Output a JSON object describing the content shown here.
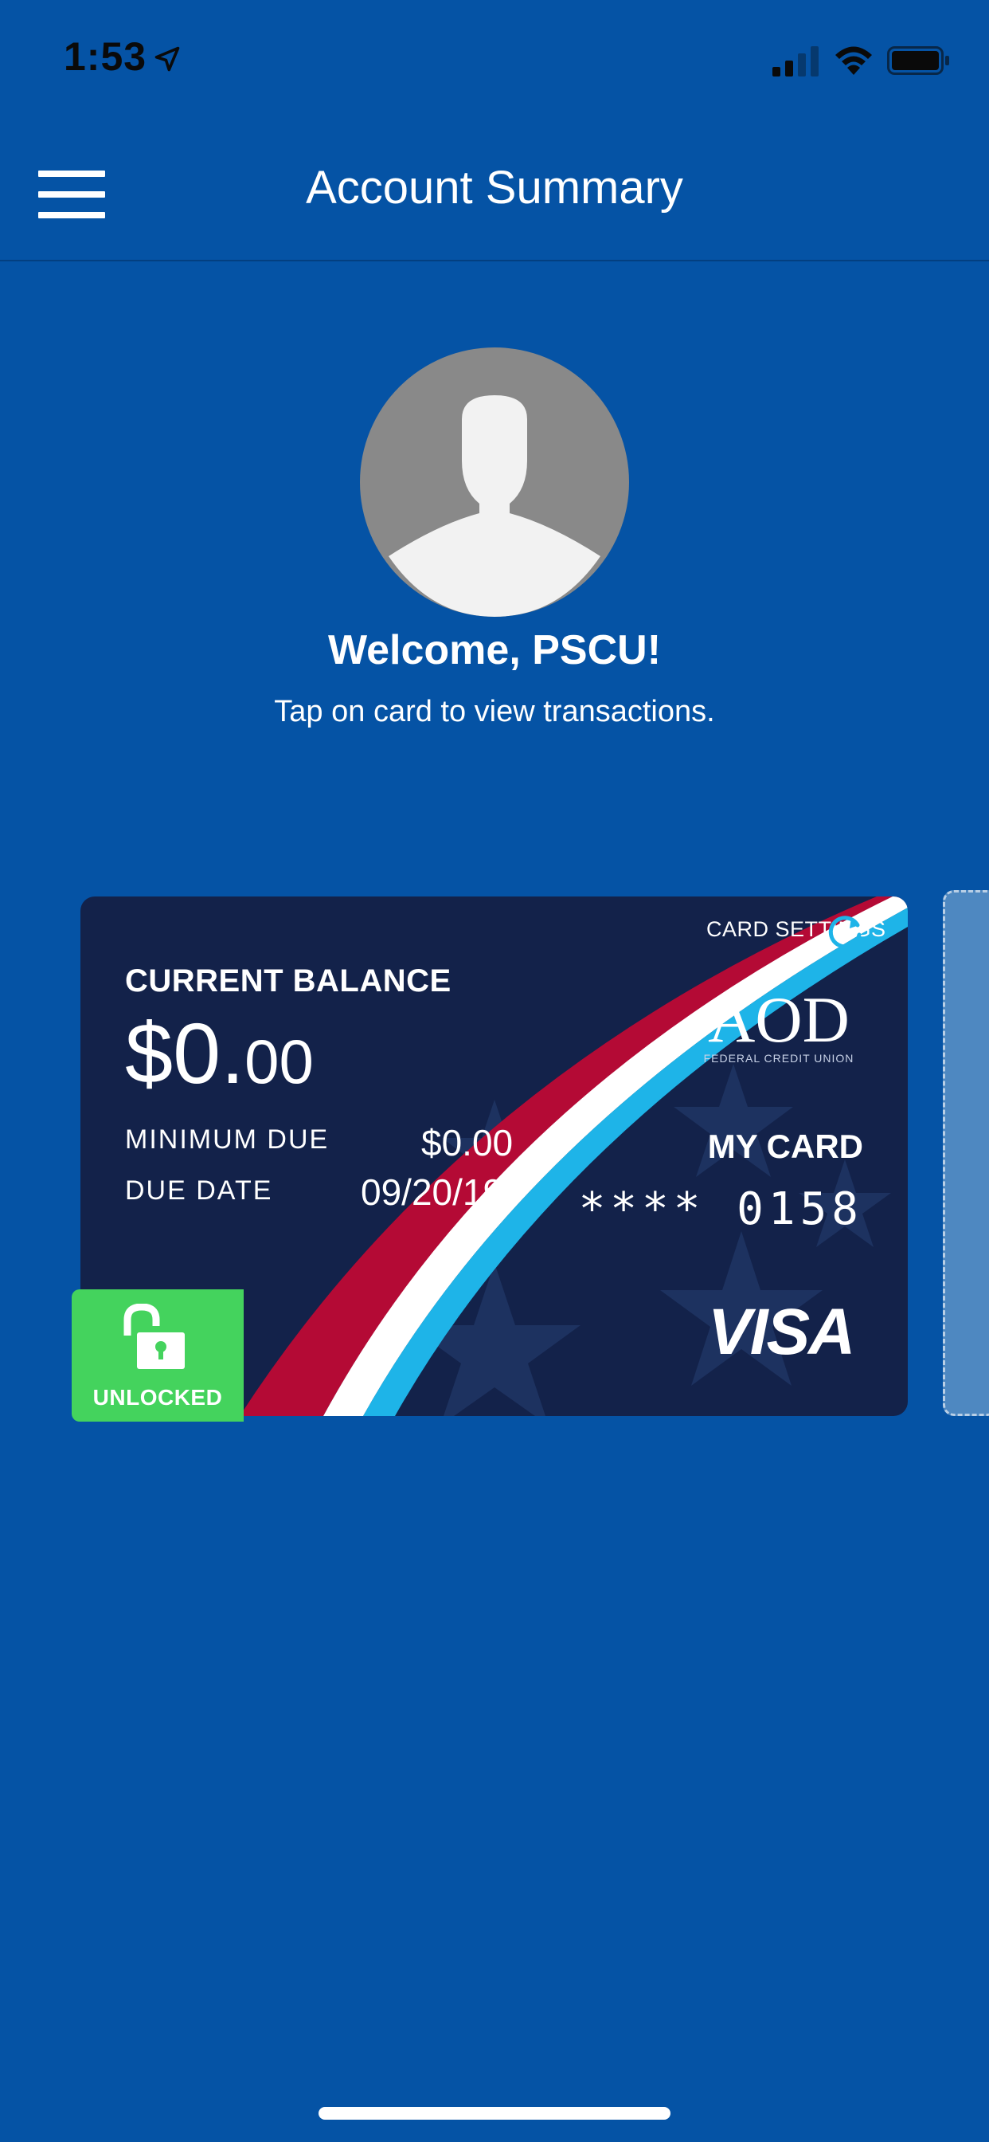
{
  "status_bar": {
    "time": "1:53",
    "icons": [
      "location-arrow-icon",
      "cellular-signal-icon",
      "wifi-icon",
      "battery-icon"
    ]
  },
  "nav": {
    "title": "Account Summary",
    "menu_icon": "hamburger-menu-icon"
  },
  "profile": {
    "avatar_icon": "user-silhouette-icon",
    "welcome": "Welcome, PSCU!",
    "instruction": "Tap on card to view transactions."
  },
  "card": {
    "settings_label": "CARD SETTINGS",
    "settings_icon": "refresh-icon",
    "balance_label": "CURRENT BALANCE",
    "balance_dollars": "$0.",
    "balance_cents": "00",
    "minimum_due_label": "MINIMUM DUE",
    "minimum_due_value": "$0.00",
    "due_date_label": "DUE DATE",
    "due_date_value": "09/20/19",
    "card_name": "MY CARD",
    "card_number_mask": "****",
    "card_number_last4": "0158",
    "network": "VISA",
    "issuer_logo_text": "AOD",
    "issuer_logo_subtext": "FEDERAL CREDIT UNION"
  },
  "lock_status": {
    "label": "UNLOCKED",
    "icon": "unlocked-padlock-icon"
  },
  "colors": {
    "background": "#0553A5",
    "card_navy": "#13224A",
    "stripe_red": "#B40A35",
    "stripe_blue": "#1EB4E8",
    "unlocked_green": "#44D35D"
  }
}
